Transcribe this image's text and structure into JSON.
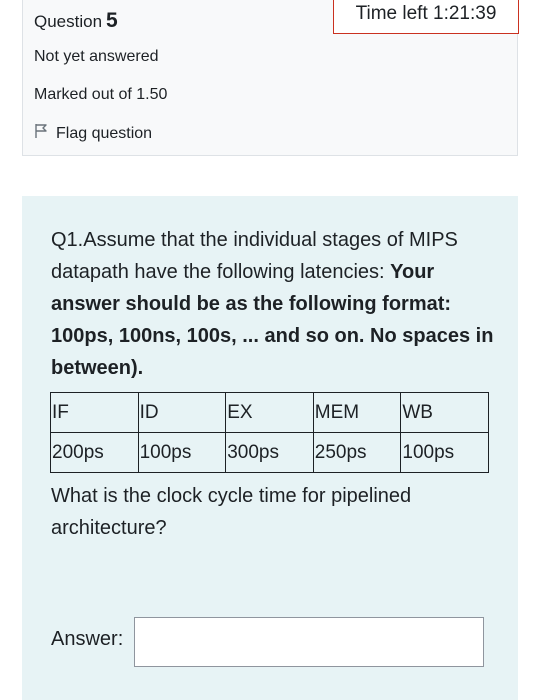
{
  "question_info": {
    "question_prefix": "Question",
    "question_number": "5",
    "state": "Not yet answered",
    "grade": "Marked out of 1.50",
    "flag_label": "Flag question"
  },
  "timer": {
    "text": "Time left 1:21:39"
  },
  "question_text": {
    "intro": "Q1.Assume that the individual stages of MIPS datapath have the following latencies: ",
    "bold": "Your answer should be as the following format: 100ps, 100ns, 100s, ... and so on. No spaces in between)."
  },
  "table": {
    "headers": [
      "IF",
      "ID",
      "EX",
      "MEM",
      "WB"
    ],
    "values": [
      "200ps",
      "100ps",
      "300ps",
      "250ps",
      "100ps"
    ]
  },
  "follow_up": "What is the clock cycle time for pipelined architecture?",
  "answer": {
    "label": "Answer:",
    "value": ""
  }
}
